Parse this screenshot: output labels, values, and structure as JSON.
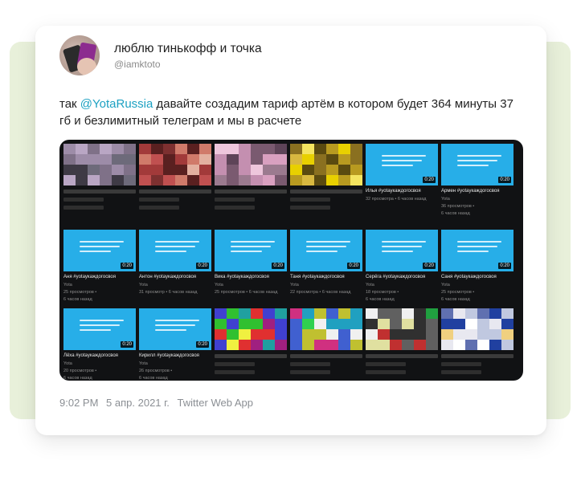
{
  "tweet": {
    "display_name": "люблю тинькофф и точка",
    "handle": "@iamktoto",
    "text_before": "так ",
    "mention": "@YotaRussia",
    "text_after": " давайте создадим тариф артём в котором будет 364 минуты 37 гб и безлимитный телеграм и мы в расчете",
    "time": "9:02 PM",
    "date": "5 апр. 2021 г.",
    "source": "Twitter Web App"
  },
  "colors": {
    "mention": "#1da1c2",
    "background_panel": "#e8f0da",
    "thumb_blue": "#27aee8"
  },
  "media": {
    "videos": [
      {
        "kind": "pixel",
        "palette": [
          "#6d6a7a",
          "#9d8ca8",
          "#d5c7e2",
          "#3e3a45",
          "#b9a6c4",
          "#7f7188"
        ]
      },
      {
        "kind": "pixel",
        "palette": [
          "#a23a3a",
          "#d07a6a",
          "#5a2020",
          "#e3b0a0",
          "#7d3030",
          "#c05050"
        ]
      },
      {
        "kind": "pixel",
        "palette": [
          "#9b7a8f",
          "#d9a0c0",
          "#5e4458",
          "#c48fb0",
          "#7a5a70",
          "#eec6dc"
        ]
      },
      {
        "kind": "pixel",
        "palette": [
          "#e8d000",
          "#b89a20",
          "#5a4a10",
          "#f4e460",
          "#8a7020",
          "#d8b840"
        ]
      },
      {
        "kind": "blue",
        "duration": "0:20",
        "title": "Илья #yotaукаждогосвоя",
        "meta": [
          "32 просмотра • 6 часов назад"
        ]
      },
      {
        "kind": "blue",
        "duration": "0:20",
        "title": "Армен #yotaукаждогосвоя",
        "meta": [
          "Yota",
          "36 просмотров •",
          "6 часов назад"
        ]
      },
      {
        "kind": "blue",
        "duration": "0:20",
        "title": "Аня #yotaукаждогосвоя",
        "meta": [
          "Yota",
          "25 просмотров •",
          "6 часов назад"
        ]
      },
      {
        "kind": "blue",
        "duration": "0:20",
        "title": "Антон #yotaукаждогосвоя",
        "meta": [
          "Yota",
          "31 просмотр • 6 часов назад"
        ]
      },
      {
        "kind": "blue",
        "duration": "0:20",
        "title": "Вика #yotaукаждогосвоя",
        "meta": [
          "Yota",
          "25 просмотров • 6 часов назад"
        ]
      },
      {
        "kind": "blue",
        "duration": "0:20",
        "title": "Таня #yotaукаждогосвоя",
        "meta": [
          "Yota",
          "22 просмотра • 6 часов назад"
        ]
      },
      {
        "kind": "blue",
        "duration": "0:20",
        "title": "Серёга #yotaукаждогосвоя",
        "meta": [
          "Yota",
          "18 просмотров •",
          "6 часов назад"
        ]
      },
      {
        "kind": "blue",
        "duration": "0:20",
        "title": "Саня #yotaукаждогосвоя",
        "meta": [
          "Yota",
          "25 просмотров •",
          "6 часов назад"
        ]
      },
      {
        "kind": "blue",
        "duration": "0:20",
        "title": "Лёха #yotaукаждогосвоя",
        "meta": [
          "Yota",
          "20 просмотров •",
          "6 часов назад"
        ]
      },
      {
        "kind": "blue",
        "duration": "0:20",
        "title": "Кирилл #yotaукаждогосвоя",
        "meta": [
          "Yota",
          "26 просмотров •",
          "6 часов назад"
        ]
      },
      {
        "kind": "pixel",
        "palette": [
          "#e03030",
          "#30c030",
          "#4040d0",
          "#f0f040",
          "#20a0a0",
          "#a02080"
        ]
      },
      {
        "kind": "pixel",
        "palette": [
          "#30d050",
          "#d03080",
          "#f0f0f0",
          "#4060d0",
          "#c0c030",
          "#20a0c0"
        ]
      },
      {
        "kind": "pixel",
        "palette": [
          "#f0f0f0",
          "#20a040",
          "#c03030",
          "#606060",
          "#e0e0a0",
          "#303030"
        ]
      },
      {
        "kind": "pixel",
        "palette": [
          "#e8e8f0",
          "#2040a0",
          "#c0c8e0",
          "#f0d080",
          "#6070b0",
          "#ffffff"
        ]
      }
    ]
  }
}
